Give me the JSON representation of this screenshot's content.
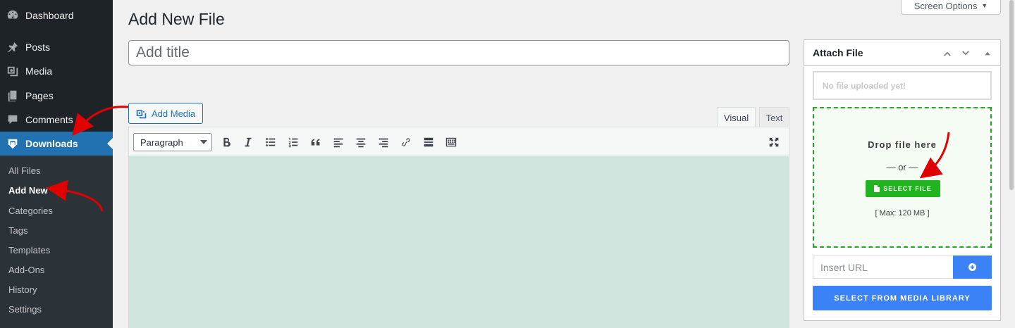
{
  "sidebar": {
    "items": [
      {
        "label": "Dashboard",
        "icon": "dashboard-icon"
      },
      {
        "label": "Posts",
        "icon": "pin-icon"
      },
      {
        "label": "Media",
        "icon": "media-icon"
      },
      {
        "label": "Pages",
        "icon": "pages-icon"
      },
      {
        "label": "Comments",
        "icon": "comments-icon"
      },
      {
        "label": "Downloads",
        "icon": "download-icon",
        "active": true
      }
    ],
    "submenu": [
      "All Files",
      "Add New",
      "Categories",
      "Tags",
      "Templates",
      "Add-Ons",
      "History",
      "Settings"
    ],
    "submenu_current": "Add New"
  },
  "header": {
    "title": "Add New File",
    "screen_options": "Screen Options"
  },
  "post": {
    "title_placeholder": "Add title",
    "title_value": ""
  },
  "editor": {
    "add_media": "Add Media",
    "tabs": [
      "Visual",
      "Text"
    ],
    "active_tab": "Visual",
    "format": "Paragraph",
    "toolbar_icons": [
      "bold-icon",
      "italic-icon",
      "bullet-list-icon",
      "numbered-list-icon",
      "blockquote-icon",
      "align-left-icon",
      "align-center-icon",
      "align-right-icon",
      "link-icon",
      "read-more-icon",
      "toolbar-toggle-icon",
      "fullscreen-icon"
    ],
    "content_bg": "#cfe5dd"
  },
  "attach": {
    "title": "Attach File",
    "status": "No file uploaded yet!",
    "drop_text": "Drop file here",
    "or_text": "— or —",
    "select_file": "SELECT FILE",
    "max_size": "[ Max: 120 MB ]",
    "url_placeholder": "Insert URL",
    "media_library": "SELECT FROM MEDIA LIBRARY"
  },
  "colors": {
    "sidebar_bg": "#1d2327",
    "submenu_bg": "#2c3338",
    "active_menu": "#2271b1",
    "select_file_green": "#20b51e",
    "primary_blue": "#3b82f6",
    "annotation_arrow": "#e00000"
  }
}
